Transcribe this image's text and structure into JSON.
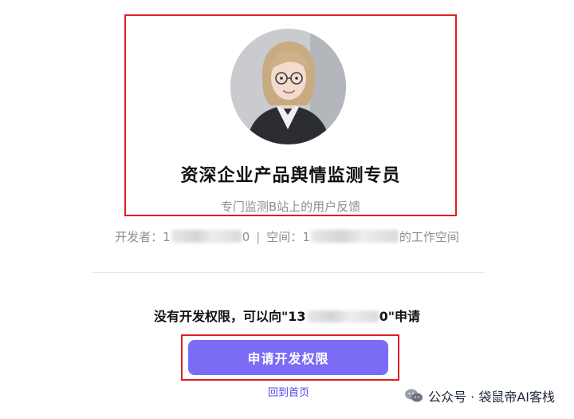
{
  "agent": {
    "title": "资深企业产品舆情监测专员",
    "subtitle": "专门监测B站上的用户反馈"
  },
  "meta": {
    "developer_label": "开发者：",
    "developer_prefix": "1",
    "developer_suffix": "0",
    "separator": "|",
    "space_label": "空间：",
    "space_prefix": "1",
    "space_suffix": "的工作空间"
  },
  "permission": {
    "message_prefix": "没有开发权限，可以向\"13",
    "message_suffix": "0\"申请",
    "apply_button_label": "申请开发权限",
    "home_link_label": "回到首页"
  },
  "watermark": {
    "text": "公众号 · 袋鼠帝AI客栈",
    "icon": "wechat-icon"
  },
  "colors": {
    "highlight_red": "#e11d24",
    "primary_button": "#7b6cf6",
    "link": "#4f46e5",
    "muted_text": "#8b8f96"
  }
}
